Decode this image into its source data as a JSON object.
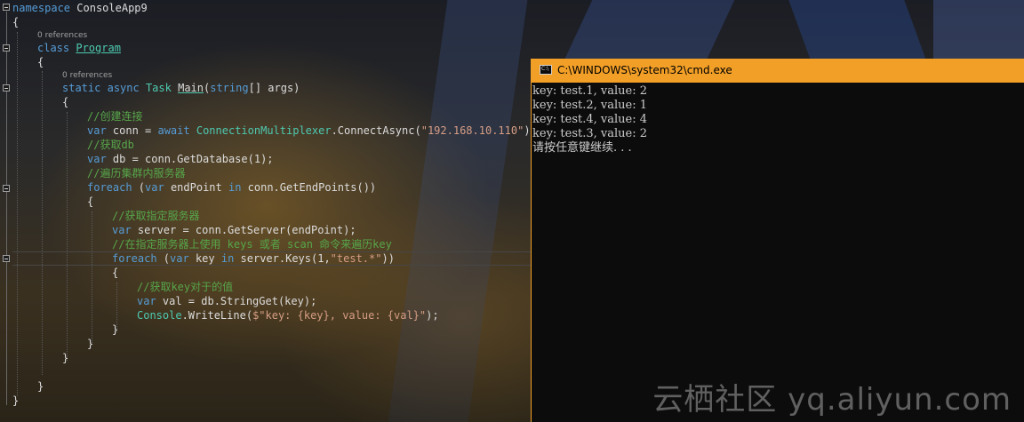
{
  "editor": {
    "lines": {
      "l1": [
        "namespace",
        "ConsoleApp9"
      ],
      "l2": "{",
      "refs1": "0 references",
      "l3": [
        "class",
        "Program"
      ],
      "l4": "{",
      "refs2": "0 references",
      "l5": [
        "static",
        "async",
        "Task",
        "Main",
        "(",
        "string",
        "[] args)"
      ],
      "l6": "{",
      "c1": "//创建连接",
      "l7": [
        "var",
        " conn = ",
        "await",
        "ConnectionMultiplexer",
        ".ConnectAsync(",
        "\"192.168.10.110\"",
        ");"
      ],
      "c2": "//获取db",
      "l8": [
        "var",
        " db = conn.GetDatabase(1);"
      ],
      "c3": "//遍历集群内服务器",
      "l9": [
        "foreach",
        " (",
        "var",
        " endPoint ",
        "in",
        " conn.GetEndPoints())"
      ],
      "l10": "{",
      "c4": "//获取指定服务器",
      "l11": [
        "var",
        " server = conn.GetServer(endPoint);"
      ],
      "c5": "//在指定服务器上使用 keys 或者 scan 命令来遍历key",
      "l12": [
        "foreach",
        " (",
        "var",
        " key ",
        "in",
        " server.Keys(1,",
        "\"test.*\"",
        "))"
      ],
      "l13": "{",
      "c6": "//获取key对于的值",
      "l14": [
        "var",
        " val = db.StringGet(key);"
      ],
      "l15": [
        "Console",
        ".WriteLine(",
        "$\"key: {key}, value: {val}\"",
        ");"
      ],
      "l16": "}",
      "l17": "}",
      "l18": "}",
      "l19": "}",
      "l20": "}"
    }
  },
  "cmd": {
    "title": "C:\\WINDOWS\\system32\\cmd.exe",
    "output": [
      "key: test.1, value: 2",
      "key: test.2, value: 1",
      "key: test.4, value: 4",
      "key: test.3, value: 2",
      "请按任意键继续. . ."
    ]
  },
  "watermark": "云栖社区 yq.aliyun.com",
  "colors": {
    "keyword": "#569cd6",
    "type": "#4ec9b0",
    "comment": "#57a64a",
    "string": "#d69d85",
    "cmd_titlebar": "#f29f27",
    "cmd_bg": "#0c0c0c"
  }
}
